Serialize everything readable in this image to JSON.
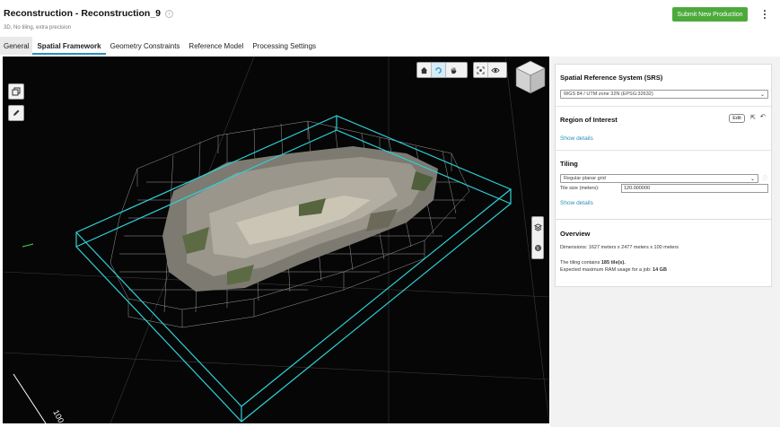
{
  "header": {
    "title": "Reconstruction - Reconstruction_9",
    "subtitle": "3D, No tiling, extra precision",
    "submit_label": "Submit New Production"
  },
  "tabs": [
    {
      "label": "General",
      "active": false
    },
    {
      "label": "Spatial Framework",
      "active": true
    },
    {
      "label": "Geometry Constraints",
      "active": false
    },
    {
      "label": "Reference Model",
      "active": false
    },
    {
      "label": "Processing Settings",
      "active": false
    }
  ],
  "viewport": {
    "axis_label": "100",
    "background": "#060606",
    "box_color": "#2fd1d8",
    "tile_color": "#bdbdbd",
    "toolbar_icons": [
      "home-icon",
      "orbit-icon",
      "pan-icon",
      "fit-icon",
      "eye-icon"
    ],
    "left_tools": [
      "box-select-icon",
      "pencil-icon"
    ],
    "side_tools": [
      "layers-icon",
      "globe-icon"
    ]
  },
  "srs": {
    "title": "Spatial Reference System (SRS)",
    "value": "WGS 84 / UTM zone 32N (EPSG:32632)"
  },
  "roi": {
    "title": "Region of Interest",
    "edit_label": "Edit",
    "show_details": "Show details"
  },
  "tiling": {
    "title": "Tiling",
    "mode": "Regular planar grid",
    "tile_size_label": "Tile size (meters):",
    "tile_size_value": "120.000000",
    "show_details": "Show details"
  },
  "overview": {
    "title": "Overview",
    "dimensions": "Dimensions: 1627 meters x 2477 meters x 100 meters",
    "tiles_prefix": "The tiling contains ",
    "tiles_count": "185 tile(s).",
    "ram_prefix": "Expected maximum RAM usage for a job: ",
    "ram_value": "14 GB"
  },
  "colors": {
    "accent": "#2a8fbf",
    "submit": "#4caa3b"
  }
}
